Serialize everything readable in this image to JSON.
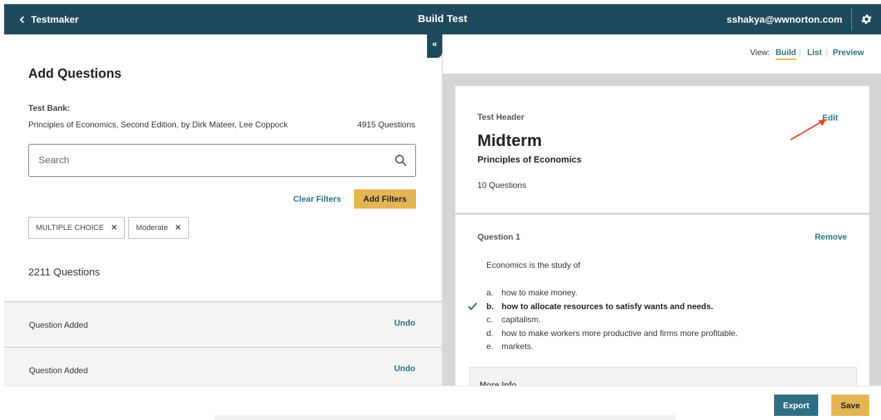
{
  "topbar": {
    "back_label": "Testmaker",
    "title": "Build Test",
    "user_email": "sshakya@wwnorton.com"
  },
  "left_panel": {
    "title": "Add Questions",
    "test_bank_label": "Test Bank:",
    "test_bank_name": "Principles of Economics, Second Edition, by Dirk Mateer, Lee Coppock",
    "test_bank_count": "4915 Questions",
    "search_placeholder": "Search",
    "clear_filters_label": "Clear Filters",
    "add_filters_label": "Add Filters",
    "filters": [
      {
        "label": "MULTIPLE CHOICE"
      },
      {
        "label": "Moderate"
      }
    ],
    "filter_remove_glyph": "✕",
    "results_count": "2211 Questions",
    "added_rows": [
      {
        "label": "Question Added",
        "action": "Undo"
      },
      {
        "label": "Question Added",
        "action": "Undo"
      }
    ]
  },
  "collapse_glyph": "«",
  "view_bar": {
    "label": "View:",
    "options": [
      "Build",
      "List",
      "Preview"
    ],
    "selected": "Build",
    "divider": "|"
  },
  "test_header": {
    "label": "Test Header",
    "edit_label": "Edit",
    "title": "Midterm",
    "subtitle": "Principles of Economics",
    "question_count": "10 Questions"
  },
  "question": {
    "label": "Question 1",
    "remove_label": "Remove",
    "stem": "Economics is the study of",
    "choices": [
      {
        "letter": "a.",
        "text": "how to make money."
      },
      {
        "letter": "b.",
        "text": "how to allocate resources to satisfy wants and needs.",
        "correct": true
      },
      {
        "letter": "c.",
        "text": "capitalism."
      },
      {
        "letter": "d.",
        "text": "how to make workers more productive and firms more profitable."
      },
      {
        "letter": "e.",
        "text": "markets."
      }
    ],
    "more_info_label": "More Info"
  },
  "footer": {
    "export_label": "Export",
    "save_label": "Save"
  },
  "colors": {
    "header_bg": "#1f4a5d",
    "link": "#2f6f85",
    "accent": "#e3b554",
    "annotation_arrow": "#e8462f"
  }
}
